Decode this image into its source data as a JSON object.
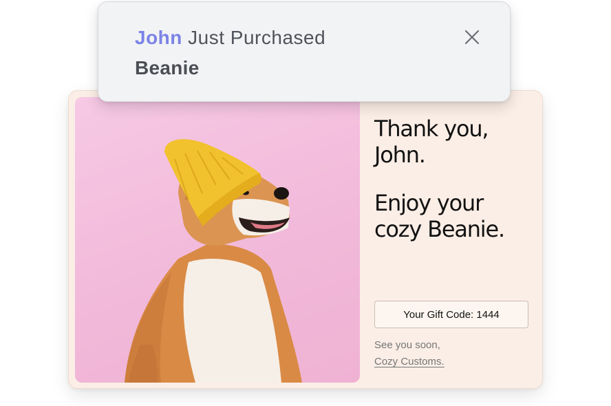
{
  "notification": {
    "customer_name": "John",
    "action_text": " Just Purchased",
    "product": "Beanie",
    "close_icon": "close-icon"
  },
  "card": {
    "image_icon": "shiba-dog-wearing-yellow-beanie",
    "thanks_line1": "Thank you,",
    "thanks_line2": "John.",
    "enjoy_line1": "Enjoy your",
    "enjoy_line2": "cozy Beanie.",
    "gift_code_label": "Your Gift Code: 1444",
    "signoff_text": "See you soon,",
    "signoff_link": "Cozy Customs."
  },
  "colors": {
    "accent_name": "#7b83e6",
    "card_background": "#fbeee6",
    "photo_background": "#f4c2df",
    "beanie_yellow": "#f2c12e"
  }
}
